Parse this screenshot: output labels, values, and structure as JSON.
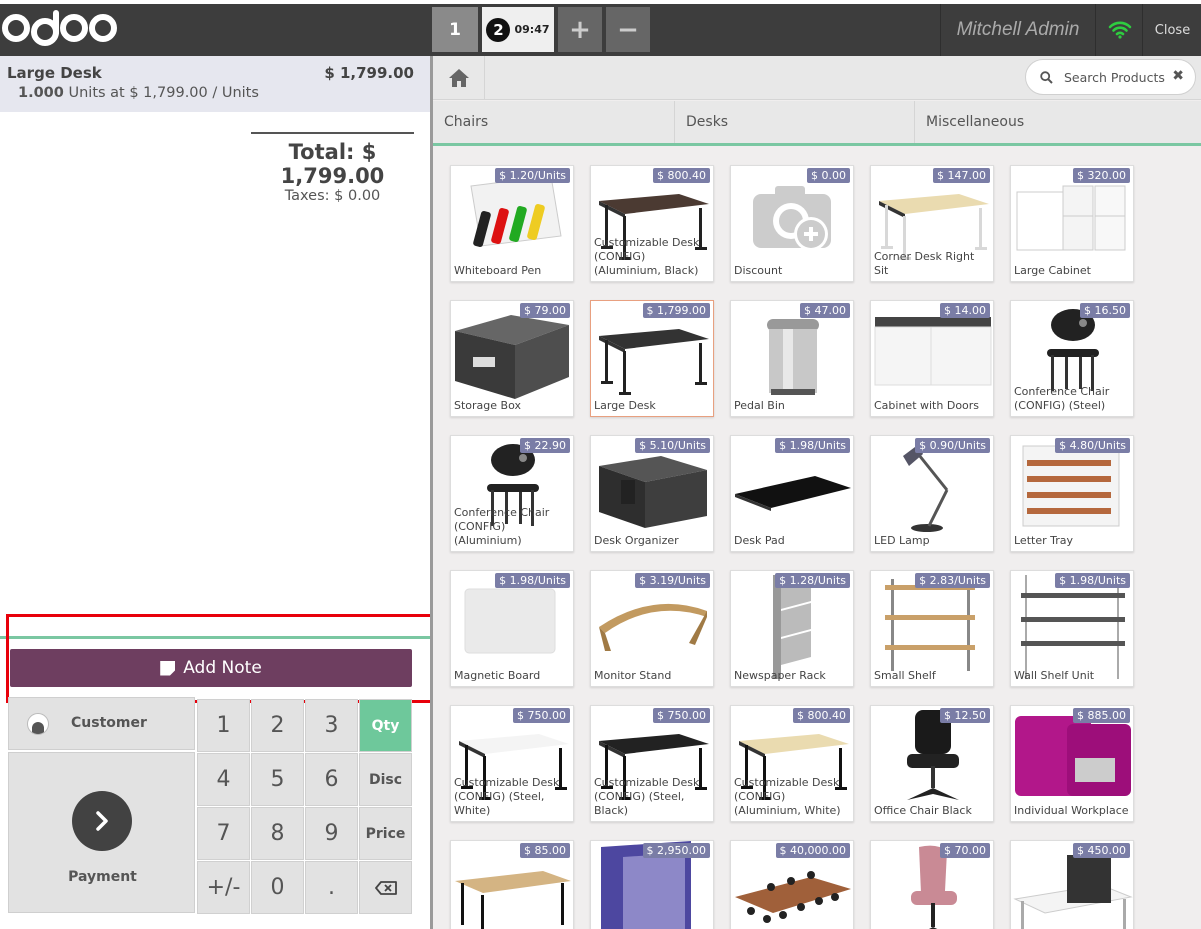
{
  "topbar": {
    "order_tabs": [
      {
        "label": "1"
      },
      {
        "label": "2",
        "time": "09:47"
      },
      {
        "label": "+"
      },
      {
        "label": "−"
      }
    ],
    "user_name": "Mitchell Admin",
    "close_label": "Close"
  },
  "order": {
    "line_name": "Large Desk",
    "line_price": "$ 1,799.00",
    "line_qty": "1.000",
    "line_info": " Units at $ 1,799.00 / Units",
    "total": "Total: $ 1,799.00",
    "taxes": "Taxes: $ 0.00"
  },
  "actions": {
    "add_note": "Add Note",
    "customer": "Customer",
    "payment": "Payment"
  },
  "numpad": {
    "keys": [
      "1",
      "2",
      "3",
      "4",
      "5",
      "6",
      "7",
      "8",
      "9",
      "+/-",
      "0",
      "."
    ],
    "modes": [
      "Qty",
      "Disc",
      "Price"
    ],
    "active_mode": "Qty"
  },
  "search": {
    "placeholder": "Search Products"
  },
  "categories": [
    "Chairs",
    "Desks",
    "Miscellaneous"
  ],
  "products": [
    {
      "name": "Whiteboard Pen",
      "price": "$ 1.20/Units"
    },
    {
      "name": "Customizable Desk (CONFIG) (Aluminium, Black)",
      "price": "$ 800.40"
    },
    {
      "name": "Discount",
      "price": "$ 0.00"
    },
    {
      "name": "Corner Desk Right Sit",
      "price": "$ 147.00"
    },
    {
      "name": "Large Cabinet",
      "price": "$ 320.00"
    },
    {
      "name": "Storage Box",
      "price": "$ 79.00"
    },
    {
      "name": "Large Desk",
      "price": "$ 1,799.00"
    },
    {
      "name": "Pedal Bin",
      "price": "$ 47.00"
    },
    {
      "name": "Cabinet with Doors",
      "price": "$ 14.00"
    },
    {
      "name": "Conference Chair (CONFIG) (Steel)",
      "price": "$ 16.50"
    },
    {
      "name": "Conference Chair (CONFIG) (Aluminium)",
      "price": "$ 22.90"
    },
    {
      "name": "Desk Organizer",
      "price": "$ 5.10/Units"
    },
    {
      "name": "Desk Pad",
      "price": "$ 1.98/Units"
    },
    {
      "name": "LED Lamp",
      "price": "$ 0.90/Units"
    },
    {
      "name": "Letter Tray",
      "price": "$ 4.80/Units"
    },
    {
      "name": "Magnetic Board",
      "price": "$ 1.98/Units"
    },
    {
      "name": "Monitor Stand",
      "price": "$ 3.19/Units"
    },
    {
      "name": "Newspaper Rack",
      "price": "$ 1.28/Units"
    },
    {
      "name": "Small Shelf",
      "price": "$ 2.83/Units"
    },
    {
      "name": "Wall Shelf Unit",
      "price": "$ 1.98/Units"
    },
    {
      "name": "Customizable Desk (CONFIG) (Steel, White)",
      "price": "$ 750.00"
    },
    {
      "name": "Customizable Desk (CONFIG) (Steel, Black)",
      "price": "$ 750.00"
    },
    {
      "name": "Customizable Desk (CONFIG) (Aluminium, White)",
      "price": "$ 800.40"
    },
    {
      "name": "Office Chair Black",
      "price": "$ 12.50"
    },
    {
      "name": "Individual Workplace",
      "price": "$ 885.00"
    },
    {
      "name": "",
      "price": "$ 85.00"
    },
    {
      "name": "",
      "price": "$ 2,950.00"
    },
    {
      "name": "",
      "price": "$ 40,000.00"
    },
    {
      "name": "",
      "price": "$ 70.00"
    },
    {
      "name": "",
      "price": "$ 450.00"
    }
  ],
  "selected_product": "Large Desk",
  "colors": {
    "accent": "#6ec89b",
    "note_button": "#6e3e60",
    "price_badge": "#7a7da6",
    "highlight": "#e8000b"
  }
}
